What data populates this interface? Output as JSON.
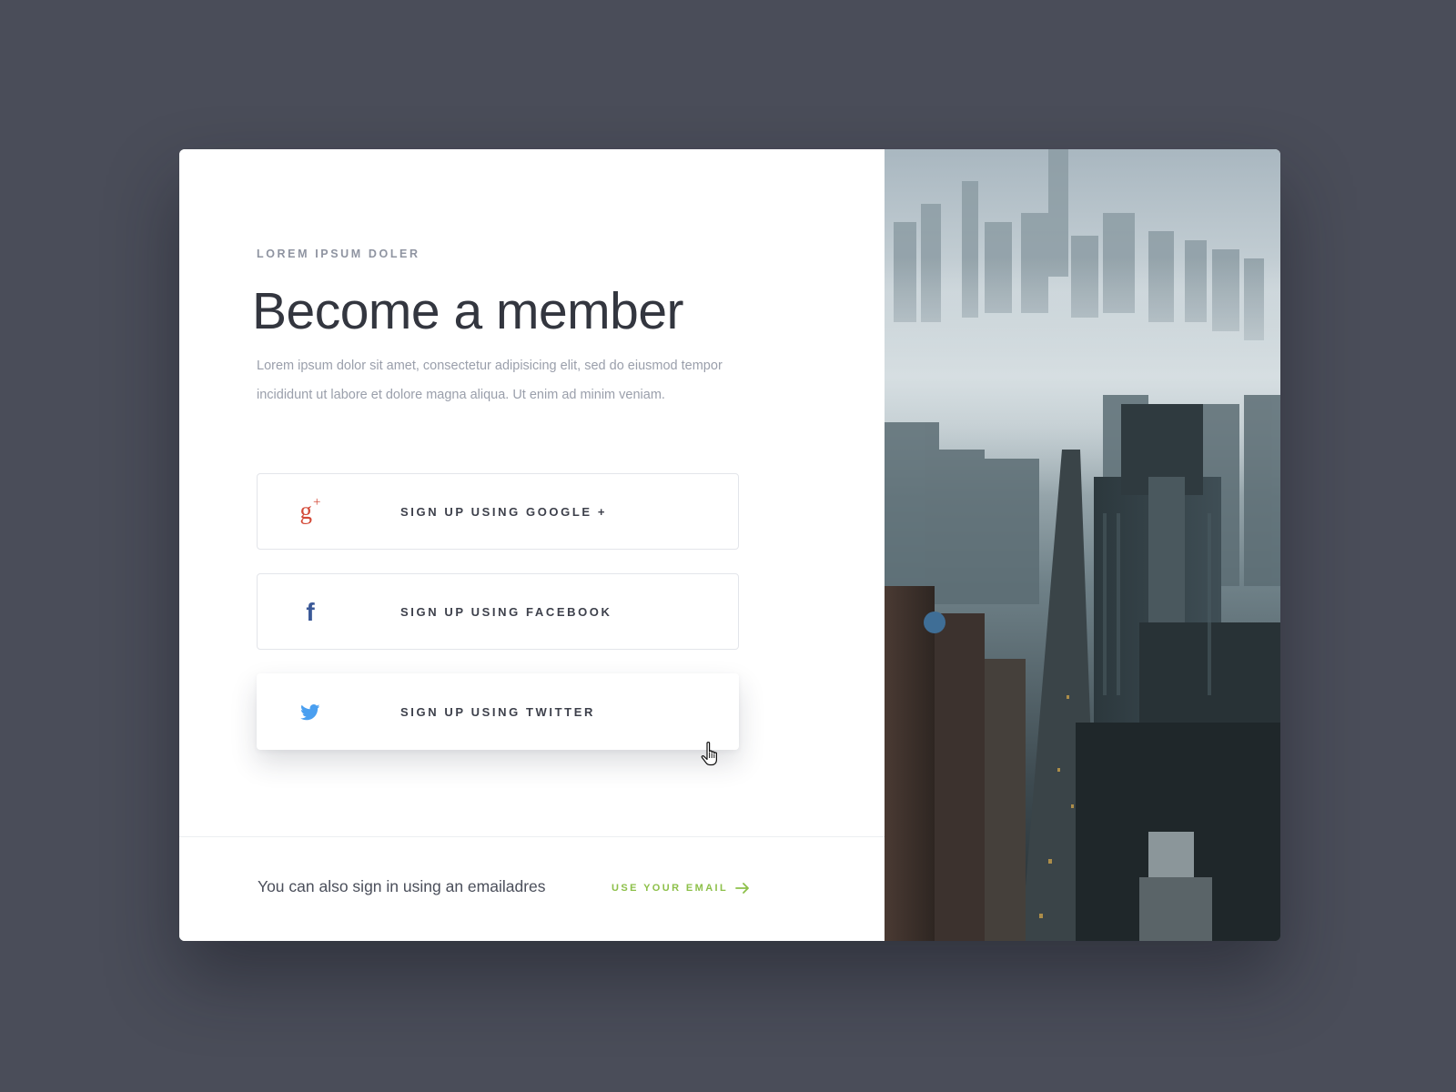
{
  "header": {
    "eyebrow": "LOREM IPSUM DOLER",
    "title": "Become a member",
    "description": "Lorem ipsum dolor sit amet, consectetur adipisicing elit, sed do eiusmod tempor incididunt ut labore et dolore magna aliqua. Ut enim ad minim veniam."
  },
  "social_buttons": [
    {
      "label": "SIGN UP USING GOOGLE +",
      "icon": "google-plus-icon",
      "icon_text": "g",
      "icon_sup": "+",
      "color": "#d34836"
    },
    {
      "label": "SIGN UP USING FACEBOOK",
      "icon": "facebook-icon",
      "icon_text": "f",
      "color": "#3b5998"
    },
    {
      "label": "SIGN UP USING TWITTER",
      "icon": "twitter-icon",
      "color": "#4a9ff0"
    }
  ],
  "footer": {
    "text": "You can also sign in using an emailadres",
    "link_label": "USE YOUR EMAIL",
    "link_icon": "arrow-right-icon",
    "link_color": "#8dc04a"
  },
  "colors": {
    "background": "#4a4d59",
    "card": "#ffffff",
    "accent_green": "#8dc04a"
  },
  "image": {
    "description_icon": "city-skyline-photo"
  }
}
